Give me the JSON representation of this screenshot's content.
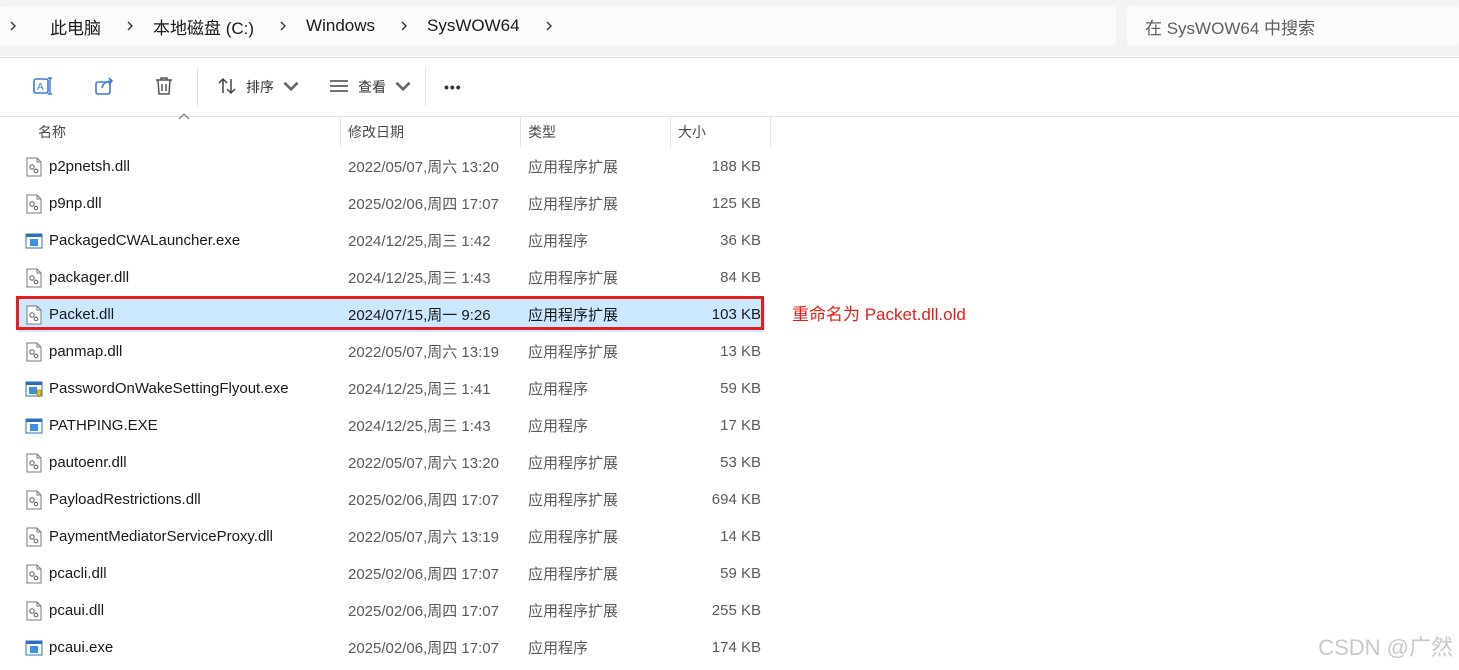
{
  "address_bar": {
    "breadcrumbs": [
      "此电脑",
      "本地磁盘 (C:)",
      "Windows",
      "SysWOW64"
    ]
  },
  "search": {
    "placeholder": "在 SysWOW64 中搜索"
  },
  "toolbar": {
    "rename_icon": "rename-icon",
    "share_icon": "share-icon",
    "delete_icon": "trash-icon",
    "sort_label": "排序",
    "view_label": "查看",
    "more_label": "•••"
  },
  "columns": {
    "name": "名称",
    "date": "修改日期",
    "type": "类型",
    "size": "大小"
  },
  "files": [
    {
      "name": "p2pnetsh.dll",
      "date": "2022/05/07,周六 13:20",
      "type": "应用程序扩展",
      "size": "188 KB",
      "icon": "dll-file-icon"
    },
    {
      "name": "p9np.dll",
      "date": "2025/02/06,周四 17:07",
      "type": "应用程序扩展",
      "size": "125 KB",
      "icon": "dll-file-icon"
    },
    {
      "name": "PackagedCWALauncher.exe",
      "date": "2024/12/25,周三 1:42",
      "type": "应用程序",
      "size": "36 KB",
      "icon": "exe-file-icon"
    },
    {
      "name": "packager.dll",
      "date": "2024/12/25,周三 1:43",
      "type": "应用程序扩展",
      "size": "84 KB",
      "icon": "dll-file-icon"
    },
    {
      "name": "Packet.dll",
      "date": "2024/07/15,周一 9:26",
      "type": "应用程序扩展",
      "size": "103 KB",
      "icon": "dll-file-icon",
      "selected": true
    },
    {
      "name": "panmap.dll",
      "date": "2022/05/07,周六 13:19",
      "type": "应用程序扩展",
      "size": "13 KB",
      "icon": "dll-file-icon"
    },
    {
      "name": "PasswordOnWakeSettingFlyout.exe",
      "date": "2024/12/25,周三 1:41",
      "type": "应用程序",
      "size": "59 KB",
      "icon": "exe-shield-file-icon"
    },
    {
      "name": "PATHPING.EXE",
      "date": "2024/12/25,周三 1:43",
      "type": "应用程序",
      "size": "17 KB",
      "icon": "exe-file-icon"
    },
    {
      "name": "pautoenr.dll",
      "date": "2022/05/07,周六 13:20",
      "type": "应用程序扩展",
      "size": "53 KB",
      "icon": "dll-file-icon"
    },
    {
      "name": "PayloadRestrictions.dll",
      "date": "2025/02/06,周四 17:07",
      "type": "应用程序扩展",
      "size": "694 KB",
      "icon": "dll-file-icon"
    },
    {
      "name": "PaymentMediatorServiceProxy.dll",
      "date": "2022/05/07,周六 13:19",
      "type": "应用程序扩展",
      "size": "14 KB",
      "icon": "dll-file-icon"
    },
    {
      "name": "pcacli.dll",
      "date": "2025/02/06,周四 17:07",
      "type": "应用程序扩展",
      "size": "59 KB",
      "icon": "dll-file-icon"
    },
    {
      "name": "pcaui.dll",
      "date": "2025/02/06,周四 17:07",
      "type": "应用程序扩展",
      "size": "255 KB",
      "icon": "dll-file-icon"
    },
    {
      "name": "pcaui.exe",
      "date": "2025/02/06,周四 17:07",
      "type": "应用程序",
      "size": "174 KB",
      "icon": "exe-file-icon"
    }
  ],
  "annotation": "重命名为 Packet.dll.old",
  "watermark": "CSDN @广然",
  "colors": {
    "selection": "#cce8ff",
    "highlight_border": "#e02020",
    "annotation": "#e0201a"
  }
}
